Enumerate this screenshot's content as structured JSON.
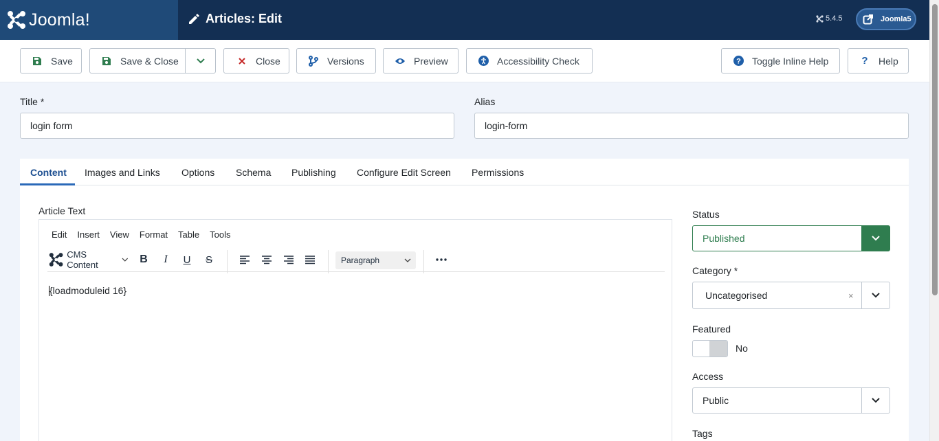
{
  "header": {
    "logo_text": "Joomla!",
    "page_title": "Articles: Edit",
    "version": "5.4.5",
    "site_button": "Joomla5"
  },
  "toolbar": {
    "save": "Save",
    "save_close": "Save & Close",
    "close": "Close",
    "versions": "Versions",
    "preview": "Preview",
    "accessibility": "Accessibility Check",
    "toggle_help": "Toggle Inline Help",
    "help": "Help"
  },
  "form": {
    "title_label": "Title *",
    "title_value": "login form",
    "alias_label": "Alias",
    "alias_value": "login-form"
  },
  "tabs": [
    "Content",
    "Images and Links",
    "Options",
    "Schema",
    "Publishing",
    "Configure Edit Screen",
    "Permissions"
  ],
  "editor": {
    "label": "Article Text",
    "menu": [
      "Edit",
      "Insert",
      "View",
      "Format",
      "Table",
      "Tools"
    ],
    "cms_content": "CMS Content",
    "block_format": "Paragraph",
    "body_text": "{loadmoduleid 16}"
  },
  "sidebar": {
    "status_label": "Status",
    "status_value": "Published",
    "category_label": "Category *",
    "category_value": "Uncategorised",
    "featured_label": "Featured",
    "featured_value": "No",
    "access_label": "Access",
    "access_value": "Public",
    "tags_label": "Tags"
  },
  "colors": {
    "header_bg": "#132f53",
    "logo_bg": "#1f4a78",
    "success": "#2f7d4f",
    "active_tab": "#1d4f91"
  }
}
